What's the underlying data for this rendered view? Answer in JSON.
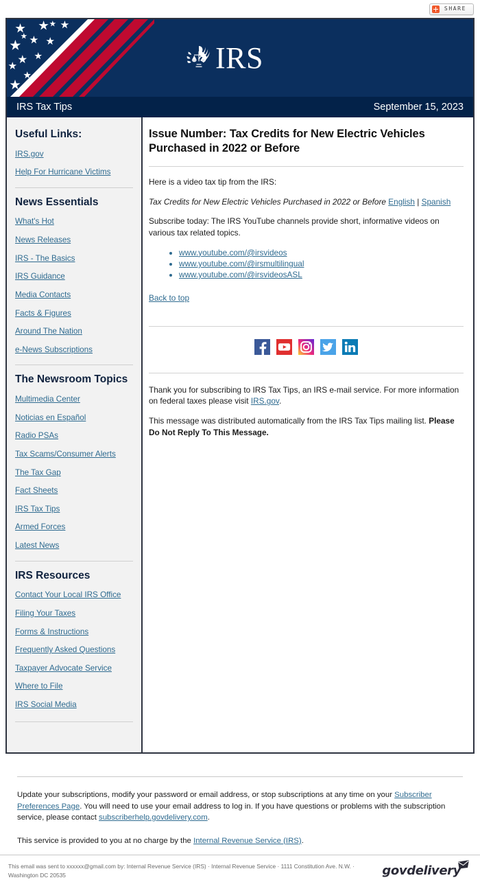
{
  "share": {
    "label": "SHARE",
    "icon": "plus-share-icon"
  },
  "banner": {
    "logo_text": "IRS",
    "flag_alt": "us-flag",
    "bg_color": "#0b2f5e"
  },
  "title_strip": {
    "publication": "IRS Tax Tips",
    "date": "September 15, 2023",
    "bg_color": "#032249"
  },
  "sidebar": {
    "sections": [
      {
        "heading": "Useful Links:",
        "links": [
          "IRS.gov",
          "Help For Hurricane Victims"
        ]
      },
      {
        "heading": "News Essentials",
        "links": [
          "What's Hot",
          "News Releases",
          "IRS - The Basics",
          "IRS Guidance",
          "Media Contacts",
          "Facts & Figures",
          "Around The Nation",
          "e-News Subscriptions"
        ]
      },
      {
        "heading": "The Newsroom Topics",
        "links": [
          "Multimedia Center",
          "Noticias en Español",
          "Radio PSAs",
          "Tax Scams/Consumer Alerts",
          "The Tax Gap",
          "Fact Sheets",
          "IRS Tax Tips",
          "Armed Forces",
          "Latest News"
        ]
      },
      {
        "heading": "IRS Resources",
        "links": [
          "Contact Your Local IRS Office",
          "Filing Your Taxes",
          "Forms & Instructions",
          "Frequently Asked Questions",
          "Taxpayer Advocate Service",
          "Where to File",
          "IRS Social Media"
        ]
      }
    ],
    "link_color": "#2f6b90",
    "bg_color": "#f2f2f2"
  },
  "content": {
    "issue_title": "Issue Number:  Tax Credits for New Electric Vehicles Purchased in 2022 or Before",
    "intro": "Here is a video tax tip from the IRS:",
    "video_title": "Tax Credits for New Electric Vehicles Purchased in 2022 or Before",
    "lang_english": "English",
    "lang_separator": "|",
    "lang_spanish": "Spanish",
    "subscribe_text": "Subscribe today: The IRS YouTube channels provide short, informative videos on various tax related topics.",
    "channels": [
      "www.youtube.com/@irsvideos",
      "www.youtube.com/@irsmultilingual",
      "www.youtube.com/@irsvideosASL"
    ],
    "back_to_top": "Back to top",
    "social": [
      {
        "name": "facebook-icon",
        "color": "#3b5998"
      },
      {
        "name": "youtube-icon",
        "color": "#e02f2f"
      },
      {
        "name": "instagram-icon",
        "color": "#d62976"
      },
      {
        "name": "twitter-icon",
        "color": "#4aa3e8"
      },
      {
        "name": "linkedin-icon",
        "color": "#0b7bb5"
      }
    ],
    "thanks_pre": "Thank you for subscribing to IRS Tax Tips, an IRS e-mail service. For more information on federal taxes please visit ",
    "thanks_link": "IRS.gov",
    "thanks_post": ".",
    "auto_pre": "This message was distributed automatically from the IRS Tax Tips mailing list. ",
    "auto_bold": "Please Do Not Reply To This Message."
  },
  "footer": {
    "update_pre": "Update your subscriptions, modify your password or email address, or stop subscriptions at any time on your ",
    "update_link": "Subscriber Preferences Page",
    "update_mid": ". You will need to use your email address to log in. If you have questions or problems with the subscription service, please contact ",
    "update_link2": "subscriberhelp.govdelivery.com",
    "update_post": ".",
    "free_pre": "This service is provided to you at no charge by the ",
    "free_link": "Internal Revenue Service (IRS)",
    "free_post": ".",
    "sent_to": "This email was sent to xxxxxx@gmail.com by: Internal Revenue Service (IRS) · Internal Revenue Service · 1111 Constitution Ave. N.W. · Washington DC 20535",
    "govdelivery_word": "govdelivery"
  }
}
